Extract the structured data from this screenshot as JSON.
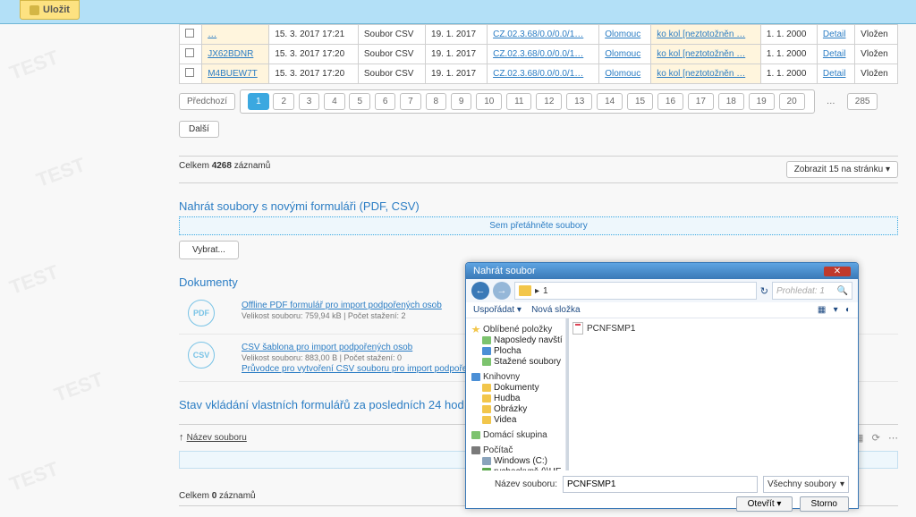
{
  "topbar": {
    "save": "Uložit"
  },
  "grid": {
    "rows": [
      {
        "id": "…",
        "date": "15. 3. 2017 17:21",
        "type": "Soubor CSV",
        "date2": "19. 1. 2017",
        "cz": "CZ.02.3.68/0.0/0.0/1…",
        "city": "Olomouc",
        "kol": "ko kol [neztotožněn …",
        "eff": "1. 1. 2000",
        "detail": "Detail",
        "status": "Vložen"
      },
      {
        "id": "JX62BDNR",
        "date": "15. 3. 2017 17:20",
        "type": "Soubor CSV",
        "date2": "19. 1. 2017",
        "cz": "CZ.02.3.68/0.0/0.0/1…",
        "city": "Olomouc",
        "kol": "ko kol [neztotožněn …",
        "eff": "1. 1. 2000",
        "detail": "Detail",
        "status": "Vložen"
      },
      {
        "id": "M4BUEW7T",
        "date": "15. 3. 2017 17:20",
        "type": "Soubor CSV",
        "date2": "19. 1. 2017",
        "cz": "CZ.02.3.68/0.0/0.0/1…",
        "city": "Olomouc",
        "kol": "ko kol [neztotožněn …",
        "eff": "1. 1. 2000",
        "detail": "Detail",
        "status": "Vložen"
      }
    ]
  },
  "pager": {
    "prev": "Předchozí",
    "pages": [
      "1",
      "2",
      "3",
      "4",
      "5",
      "6",
      "7",
      "8",
      "9",
      "10",
      "11",
      "12",
      "13",
      "14",
      "15",
      "16",
      "17",
      "18",
      "19",
      "20"
    ],
    "ell": "…",
    "last": "285",
    "next": "Další"
  },
  "summary": {
    "left_a": "Celkem ",
    "left_b": "4268",
    "left_c": " záznamů",
    "perpage": "Zobrazit 15 na stránku"
  },
  "upload": {
    "title": "Nahrát soubory s novými formuláři (PDF, CSV)",
    "drop": "Sem přetáhněte soubory",
    "pick": "Vybrat..."
  },
  "docs": {
    "title": "Dokumenty",
    "pdf": {
      "badge": "PDF",
      "link": "Offline PDF formulář pro import podpořených osob",
      "meta": "Velikost souboru: 759,94 kB | Počet stažení: 2"
    },
    "csv": {
      "badge": "CSV",
      "link": "CSV šablona pro import podpořených osob",
      "meta": "Velikost souboru: 883,00 B | Počet stažení: 0",
      "guide": "Průvodce pro vytvoření CSV souboru pro import podpořených osob"
    }
  },
  "stav": {
    "title": "Stav vkládání vlastních formulářů za posledních 24 hod",
    "col": "Název souboru",
    "empty_a": "Celkem ",
    "empty_b": "0",
    "empty_c": " záznamů"
  },
  "dialog": {
    "title": "Nahrát soubor",
    "crumb_folder": "1",
    "search_ph": "Prohledat: 1",
    "toolbar": {
      "org": "Uspořádat",
      "new": "Nová složka"
    },
    "tree": {
      "fav": "Oblíbené položky",
      "fav_items": [
        "Naposledy navští",
        "Plocha",
        "Stažené soubory"
      ],
      "lib": "Knihovny",
      "lib_items": [
        "Dokumenty",
        "Hudba",
        "Obrázky",
        "Videa"
      ],
      "home": "Domácí skupina",
      "pc": "Počítač",
      "pc_items": [
        "Windows (C:)",
        "rycheckypš (\\\\HE"
      ]
    },
    "file": "PCNFSMP1",
    "fname_lbl": "Název souboru:",
    "fname_val": "PCNFSMP1",
    "filter": "Všechny soubory",
    "open": "Otevřít",
    "cancel": "Storno"
  }
}
